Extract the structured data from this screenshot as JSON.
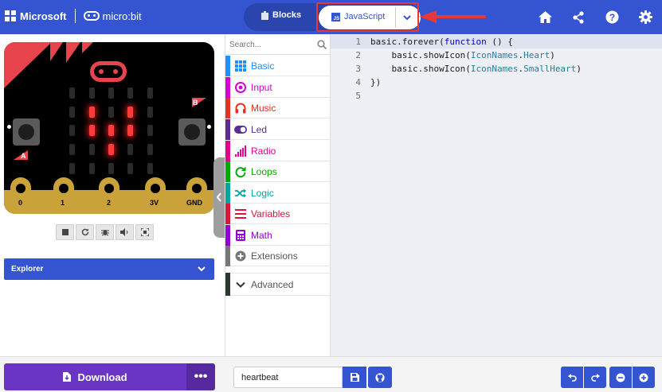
{
  "header": {
    "brand_microsoft": "Microsoft",
    "brand_microbit": "micro:bit",
    "blocks_label": "Blocks",
    "javascript_label": "JavaScript",
    "js_badge": "JS",
    "icons": [
      "home-icon",
      "share-icon",
      "help-icon",
      "settings-icon"
    ],
    "colors": {
      "header_bg": "#3454d1",
      "toggle_bg": "#2b45ae",
      "highlight": "#e53935"
    }
  },
  "simulator": {
    "button_a": "A",
    "button_b": "B",
    "pins": [
      "0",
      "1",
      "2",
      "3V",
      "GND"
    ],
    "led_grid_lit": [
      [
        0,
        0,
        0,
        0,
        0
      ],
      [
        0,
        1,
        0,
        1,
        0
      ],
      [
        0,
        1,
        1,
        1,
        0
      ],
      [
        0,
        0,
        1,
        0,
        0
      ],
      [
        0,
        0,
        0,
        0,
        0
      ]
    ],
    "tools": [
      "stop-icon",
      "restart-icon",
      "debug-icon",
      "mute-icon",
      "fullscreen-icon"
    ]
  },
  "explorer": {
    "label": "Explorer"
  },
  "toolbox": {
    "search_placeholder": "Search...",
    "categories": [
      {
        "label": "Basic",
        "color": "#1e90ff",
        "icon": "grid-icon"
      },
      {
        "label": "Input",
        "color": "#d400d4",
        "icon": "target-icon"
      },
      {
        "label": "Music",
        "color": "#e63022",
        "icon": "headphones-icon"
      },
      {
        "label": "Led",
        "color": "#5c2d91",
        "icon": "toggle-icon"
      },
      {
        "label": "Radio",
        "color": "#e3008c",
        "icon": "signal-icon"
      },
      {
        "label": "Loops",
        "color": "#00aa00",
        "icon": "loop-icon"
      },
      {
        "label": "Logic",
        "color": "#00a4a6",
        "icon": "shuffle-icon"
      },
      {
        "label": "Variables",
        "color": "#dc143c",
        "icon": "list-icon"
      },
      {
        "label": "Math",
        "color": "#9400d3",
        "icon": "calculator-icon"
      },
      {
        "label": "Extensions",
        "color": "#777777",
        "icon": "plus-circle-icon"
      },
      {
        "label": "Advanced",
        "color": "#2a3a2e",
        "icon": "chevron-down-icon"
      }
    ]
  },
  "editor": {
    "lines": [
      {
        "num": "1",
        "segments": [
          [
            "basic.forever(",
            ""
          ],
          [
            "function",
            "kw"
          ],
          [
            " () {",
            ""
          ]
        ]
      },
      {
        "num": "2",
        "segments": [
          [
            "    basic.showIcon(",
            ""
          ],
          [
            "IconNames",
            "ty"
          ],
          [
            ".",
            ""
          ],
          [
            "Heart",
            "ty"
          ],
          [
            ")",
            ""
          ]
        ]
      },
      {
        "num": "3",
        "segments": [
          [
            "    basic.showIcon(",
            ""
          ],
          [
            "IconNames",
            "ty"
          ],
          [
            ".",
            ""
          ],
          [
            "SmallHeart",
            "ty"
          ],
          [
            ")",
            ""
          ]
        ]
      },
      {
        "num": "4",
        "segments": [
          [
            "})",
            ""
          ]
        ]
      },
      {
        "num": "5",
        "segments": []
      }
    ]
  },
  "bottom": {
    "download_label": "Download",
    "more_label": "•••",
    "project_name": "heartbeat"
  }
}
